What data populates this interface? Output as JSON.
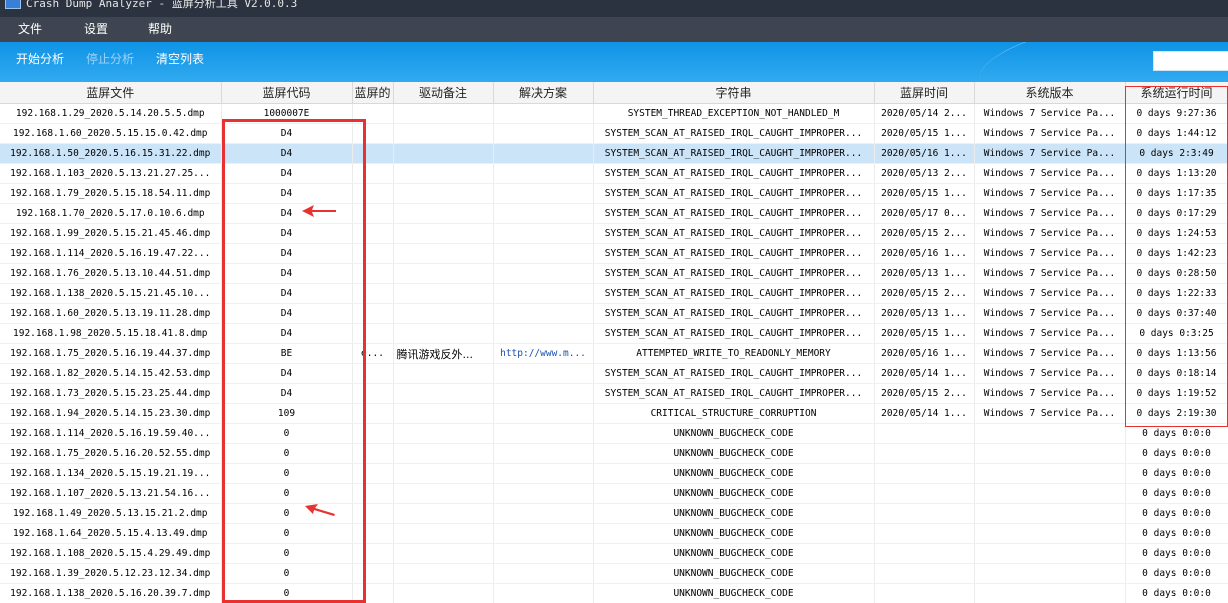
{
  "window": {
    "title": "Crash Dump Analyzer - 蓝屏分析工具 V2.0.0.3"
  },
  "menu": [
    {
      "label": "文件"
    },
    {
      "label": "设置"
    },
    {
      "label": "帮助"
    }
  ],
  "toolbar": {
    "start": "开始分析",
    "stop": "停止分析",
    "clear": "清空列表"
  },
  "columns": [
    "蓝屏文件",
    "蓝屏代码",
    "蓝屏的",
    "驱动备注",
    "解决方案",
    "字符串",
    "蓝屏时间",
    "系统版本",
    "系统运行时间"
  ],
  "rows": [
    {
      "file": "192.168.1.29_2020.5.14.20.5.5.dmp",
      "code": "1000007E",
      "blue": "",
      "driver": "",
      "solution": "",
      "string": "SYSTEM_THREAD_EXCEPTION_NOT_HANDLED_M",
      "time": "2020/05/14 2...",
      "os": "Windows 7 Service Pa...",
      "uptime": "0 days 9:27:36"
    },
    {
      "file": "192.168.1.60_2020.5.15.15.0.42.dmp",
      "code": "D4",
      "blue": "",
      "driver": "",
      "solution": "",
      "string": "SYSTEM_SCAN_AT_RAISED_IRQL_CAUGHT_IMPROPER...",
      "time": "2020/05/15 1...",
      "os": "Windows 7 Service Pa...",
      "uptime": "0 days 1:44:12"
    },
    {
      "file": "192.168.1.50_2020.5.16.15.31.22.dmp",
      "code": "D4",
      "blue": "",
      "driver": "",
      "solution": "",
      "string": "SYSTEM_SCAN_AT_RAISED_IRQL_CAUGHT_IMPROPER...",
      "time": "2020/05/16 1...",
      "os": "Windows 7 Service Pa...",
      "uptime": "0 days 2:3:49",
      "selected": true
    },
    {
      "file": "192.168.1.103_2020.5.13.21.27.25...",
      "code": "D4",
      "blue": "",
      "driver": "",
      "solution": "",
      "string": "SYSTEM_SCAN_AT_RAISED_IRQL_CAUGHT_IMPROPER...",
      "time": "2020/05/13 2...",
      "os": "Windows 7 Service Pa...",
      "uptime": "0 days 1:13:20"
    },
    {
      "file": "192.168.1.79_2020.5.15.18.54.11.dmp",
      "code": "D4",
      "blue": "",
      "driver": "",
      "solution": "",
      "string": "SYSTEM_SCAN_AT_RAISED_IRQL_CAUGHT_IMPROPER...",
      "time": "2020/05/15 1...",
      "os": "Windows 7 Service Pa...",
      "uptime": "0 days 1:17:35"
    },
    {
      "file": "192.168.1.70_2020.5.17.0.10.6.dmp",
      "code": "D4",
      "blue": "",
      "driver": "",
      "solution": "",
      "string": "SYSTEM_SCAN_AT_RAISED_IRQL_CAUGHT_IMPROPER...",
      "time": "2020/05/17 0...",
      "os": "Windows 7 Service Pa...",
      "uptime": "0 days 0:17:29"
    },
    {
      "file": "192.168.1.99_2020.5.15.21.45.46.dmp",
      "code": "D4",
      "blue": "",
      "driver": "",
      "solution": "",
      "string": "SYSTEM_SCAN_AT_RAISED_IRQL_CAUGHT_IMPROPER...",
      "time": "2020/05/15 2...",
      "os": "Windows 7 Service Pa...",
      "uptime": "0 days 1:24:53"
    },
    {
      "file": "192.168.1.114_2020.5.16.19.47.22...",
      "code": "D4",
      "blue": "",
      "driver": "",
      "solution": "",
      "string": "SYSTEM_SCAN_AT_RAISED_IRQL_CAUGHT_IMPROPER...",
      "time": "2020/05/16 1...",
      "os": "Windows 7 Service Pa...",
      "uptime": "0 days 1:42:23"
    },
    {
      "file": "192.168.1.76_2020.5.13.10.44.51.dmp",
      "code": "D4",
      "blue": "",
      "driver": "",
      "solution": "",
      "string": "SYSTEM_SCAN_AT_RAISED_IRQL_CAUGHT_IMPROPER...",
      "time": "2020/05/13 1...",
      "os": "Windows 7 Service Pa...",
      "uptime": "0 days 0:28:50"
    },
    {
      "file": "192.168.1.138_2020.5.15.21.45.10...",
      "code": "D4",
      "blue": "",
      "driver": "",
      "solution": "",
      "string": "SYSTEM_SCAN_AT_RAISED_IRQL_CAUGHT_IMPROPER...",
      "time": "2020/05/15 2...",
      "os": "Windows 7 Service Pa...",
      "uptime": "0 days 1:22:33"
    },
    {
      "file": "192.168.1.60_2020.5.13.19.11.28.dmp",
      "code": "D4",
      "blue": "",
      "driver": "",
      "solution": "",
      "string": "SYSTEM_SCAN_AT_RAISED_IRQL_CAUGHT_IMPROPER...",
      "time": "2020/05/13 1...",
      "os": "Windows 7 Service Pa...",
      "uptime": "0 days 0:37:40"
    },
    {
      "file": "192.168.1.98_2020.5.15.18.41.8.dmp",
      "code": "D4",
      "blue": "",
      "driver": "",
      "solution": "",
      "string": "SYSTEM_SCAN_AT_RAISED_IRQL_CAUGHT_IMPROPER...",
      "time": "2020/05/15 1...",
      "os": "Windows 7 Service Pa...",
      "uptime": "0 days 0:3:25"
    },
    {
      "file": "192.168.1.75_2020.5.16.19.44.37.dmp",
      "code": "BE",
      "blue": "e...",
      "driver": "腾讯游戏反外...",
      "solution": "http://www.m...",
      "string": "ATTEMPTED_WRITE_TO_READONLY_MEMORY",
      "time": "2020/05/16 1...",
      "os": "Windows 7 Service Pa...",
      "uptime": "0 days 1:13:56"
    },
    {
      "file": "192.168.1.82_2020.5.14.15.42.53.dmp",
      "code": "D4",
      "blue": "",
      "driver": "",
      "solution": "",
      "string": "SYSTEM_SCAN_AT_RAISED_IRQL_CAUGHT_IMPROPER...",
      "time": "2020/05/14 1...",
      "os": "Windows 7 Service Pa...",
      "uptime": "0 days 0:18:14"
    },
    {
      "file": "192.168.1.73_2020.5.15.23.25.44.dmp",
      "code": "D4",
      "blue": "",
      "driver": "",
      "solution": "",
      "string": "SYSTEM_SCAN_AT_RAISED_IRQL_CAUGHT_IMPROPER...",
      "time": "2020/05/15 2...",
      "os": "Windows 7 Service Pa...",
      "uptime": "0 days 1:19:52"
    },
    {
      "file": "192.168.1.94_2020.5.14.15.23.30.dmp",
      "code": "109",
      "blue": "",
      "driver": "",
      "solution": "",
      "string": "CRITICAL_STRUCTURE_CORRUPTION",
      "time": "2020/05/14 1...",
      "os": "Windows 7 Service Pa...",
      "uptime": "0 days 2:19:30"
    },
    {
      "file": "192.168.1.114_2020.5.16.19.59.40...",
      "code": "0",
      "blue": "",
      "driver": "",
      "solution": "",
      "string": "UNKNOWN_BUGCHECK_CODE",
      "time": "",
      "os": "",
      "uptime": "0 days 0:0:0"
    },
    {
      "file": "192.168.1.75_2020.5.16.20.52.55.dmp",
      "code": "0",
      "blue": "",
      "driver": "",
      "solution": "",
      "string": "UNKNOWN_BUGCHECK_CODE",
      "time": "",
      "os": "",
      "uptime": "0 days 0:0:0"
    },
    {
      "file": "192.168.1.134_2020.5.15.19.21.19...",
      "code": "0",
      "blue": "",
      "driver": "",
      "solution": "",
      "string": "UNKNOWN_BUGCHECK_CODE",
      "time": "",
      "os": "",
      "uptime": "0 days 0:0:0"
    },
    {
      "file": "192.168.1.107_2020.5.13.21.54.16...",
      "code": "0",
      "blue": "",
      "driver": "",
      "solution": "",
      "string": "UNKNOWN_BUGCHECK_CODE",
      "time": "",
      "os": "",
      "uptime": "0 days 0:0:0"
    },
    {
      "file": "192.168.1.49_2020.5.13.15.21.2.dmp",
      "code": "0",
      "blue": "",
      "driver": "",
      "solution": "",
      "string": "UNKNOWN_BUGCHECK_CODE",
      "time": "",
      "os": "",
      "uptime": "0 days 0:0:0"
    },
    {
      "file": "192.168.1.64_2020.5.15.4.13.49.dmp",
      "code": "0",
      "blue": "",
      "driver": "",
      "solution": "",
      "string": "UNKNOWN_BUGCHECK_CODE",
      "time": "",
      "os": "",
      "uptime": "0 days 0:0:0"
    },
    {
      "file": "192.168.1.108_2020.5.15.4.29.49.dmp",
      "code": "0",
      "blue": "",
      "driver": "",
      "solution": "",
      "string": "UNKNOWN_BUGCHECK_CODE",
      "time": "",
      "os": "",
      "uptime": "0 days 0:0:0"
    },
    {
      "file": "192.168.1.39_2020.5.12.23.12.34.dmp",
      "code": "0",
      "blue": "",
      "driver": "",
      "solution": "",
      "string": "UNKNOWN_BUGCHECK_CODE",
      "time": "",
      "os": "",
      "uptime": "0 days 0:0:0"
    },
    {
      "file": "192.168.1.138_2020.5.16.20.39.7.dmp",
      "code": "0",
      "blue": "",
      "driver": "",
      "solution": "",
      "string": "UNKNOWN_BUGCHECK_CODE",
      "time": "",
      "os": "",
      "uptime": "0 days 0:0:0"
    }
  ],
  "colors": {
    "highlight": "#e83232",
    "toolbar": "#1a9de9",
    "selection": "#cce4f7"
  }
}
